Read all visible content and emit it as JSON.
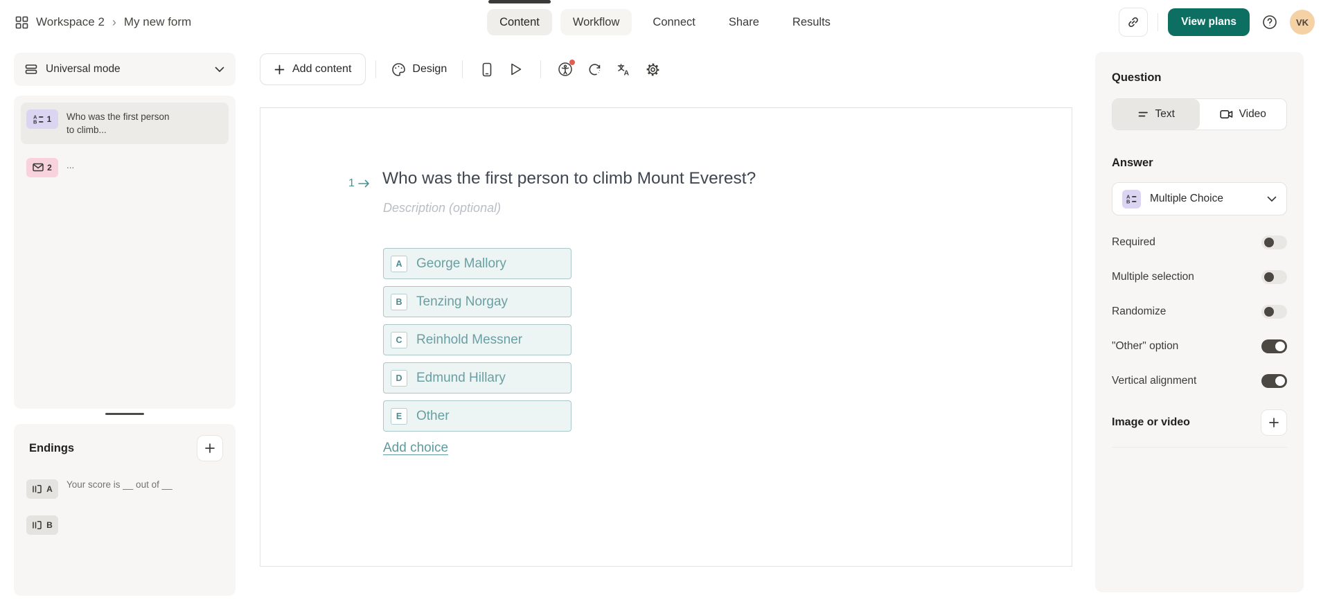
{
  "header": {
    "breadcrumb": {
      "workspace": "Workspace 2",
      "separator": "›",
      "form_name": "My new form"
    },
    "tabs": [
      {
        "label": "Content",
        "active": true,
        "pill": true
      },
      {
        "label": "Workflow",
        "active": false,
        "pill": true
      },
      {
        "label": "Connect",
        "active": false,
        "pill": false
      },
      {
        "label": "Share",
        "active": false,
        "pill": false
      },
      {
        "label": "Results",
        "active": false,
        "pill": false
      }
    ],
    "view_plans_label": "View plans",
    "avatar_initials": "VK"
  },
  "toolbar": {
    "add_content_label": "Add content",
    "design_label": "Design"
  },
  "sidebar": {
    "mode_selector": "Universal mode",
    "questions": [
      {
        "number": "1",
        "label": "Who was the first person to climb...",
        "type": "multiple-choice",
        "selected": true
      },
      {
        "number": "2",
        "label": "...",
        "type": "email",
        "selected": false
      }
    ],
    "endings_title": "Endings",
    "endings": [
      {
        "letter": "A",
        "label": "Your score is __ out of __"
      },
      {
        "letter": "B",
        "label": ""
      }
    ]
  },
  "canvas": {
    "question_number": "1",
    "question_title": "Who was the first person to climb Mount Everest?",
    "description_placeholder": "Description (optional)",
    "choices": [
      {
        "key": "A",
        "label": "George Mallory"
      },
      {
        "key": "B",
        "label": "Tenzing Norgay"
      },
      {
        "key": "C",
        "label": "Reinhold Messner"
      },
      {
        "key": "D",
        "label": "Edmund Hillary"
      },
      {
        "key": "E",
        "label": "Other"
      }
    ],
    "add_choice_label": "Add choice"
  },
  "panel": {
    "question_section_title": "Question",
    "type_options": [
      {
        "label": "Text",
        "selected": true
      },
      {
        "label": "Video",
        "selected": false
      }
    ],
    "answer_section_title": "Answer",
    "answer_type": "Multiple Choice",
    "settings": [
      {
        "label": "Required",
        "enabled": false
      },
      {
        "label": "Multiple selection",
        "enabled": false
      },
      {
        "label": "Randomize",
        "enabled": false
      },
      {
        "label": "\"Other\" option",
        "enabled": true
      },
      {
        "label": "Vertical alignment",
        "enabled": true
      }
    ],
    "image_section_title": "Image or video"
  },
  "colors": {
    "brand_green": "#0d6e62",
    "accent_teal": "#699fa2",
    "choice_bg": "#edf4f4",
    "choice_border": "#a9c7c8",
    "badge_purple": "#dcd5f2",
    "badge_pink": "#f8d2dc",
    "badge_gray": "#e5e3df",
    "toggle_on": "#4b4844",
    "avatar_bg": "#f4d2a6",
    "notification_red": "#e05e52",
    "panel_bg": "#f7f6f4"
  }
}
